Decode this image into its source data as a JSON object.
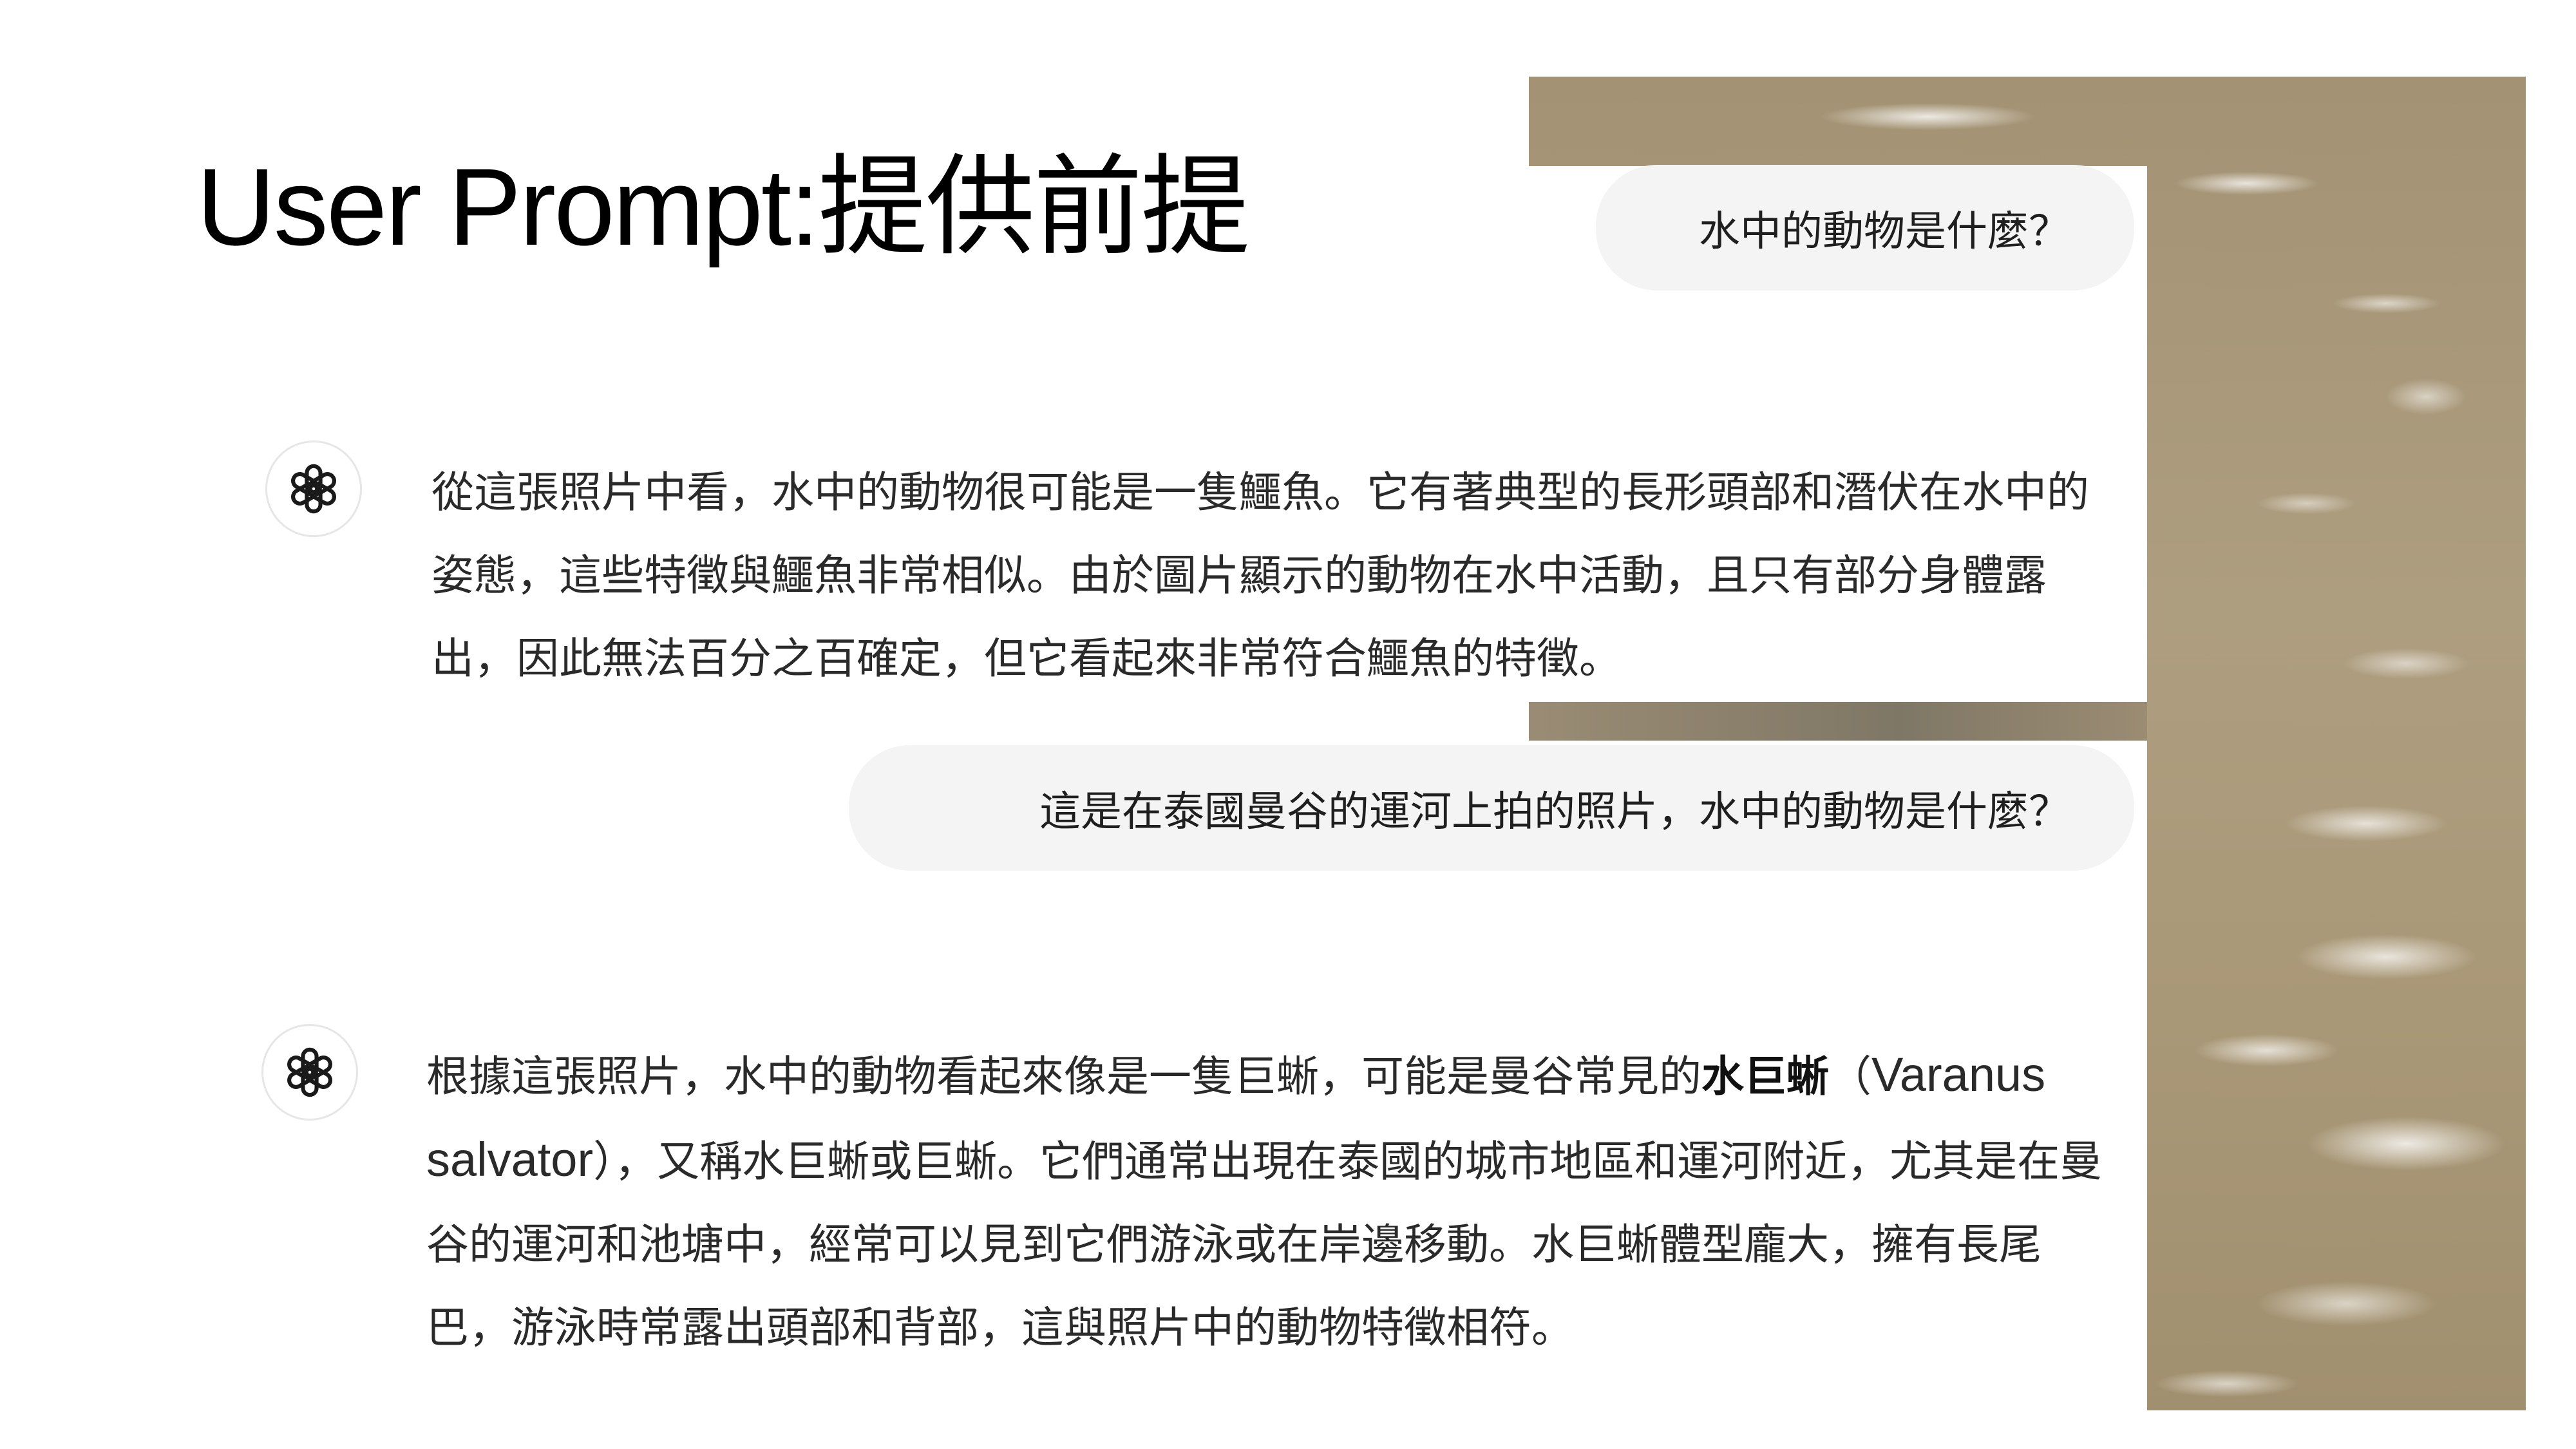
{
  "slide": {
    "title": "User Prompt:提供前提"
  },
  "conversation": {
    "user_message_1": "水中的動物是什麼？",
    "assistant_message_1": "從這張照片中看，水中的動物很可能是一隻鱷魚。它有著典型的長形頭部和潛伏在水中的姿態，這些特徵與鱷魚非常相似。由於圖片顯示的動物在水中活動，且只有部分身體露出，因此無法百分之百確定，但它看起來非常符合鱷魚的特徵。",
    "user_message_2": "這是在泰國曼谷的運河上拍的照片，水中的動物是什麼？",
    "assistant_message_2": {
      "part1": "根據這張照片，水中的動物看起來像是一隻巨蜥，可能是曼谷常見的",
      "bold": "水巨蜥",
      "paren_open": "（",
      "latin": "Varanus salvator",
      "paren_close": "）",
      "part2": "，又稱水巨蜥或巨蜥。它們通常出現在泰國的城市地區和運河附近，尤其是在曼谷的運河和池塘中，經常可以見到它們游泳或在岸邊移動。水巨蜥體型龐大，擁有長尾巴，游泳時常露出頭部和背部，這與照片中的動物特徵相符。"
    }
  },
  "icons": {
    "assistant_avatar": "openai-logo-icon"
  },
  "colors": {
    "bubble_bg": "#f4f4f4",
    "text": "#2a2a2a",
    "water": "#a8977a"
  }
}
